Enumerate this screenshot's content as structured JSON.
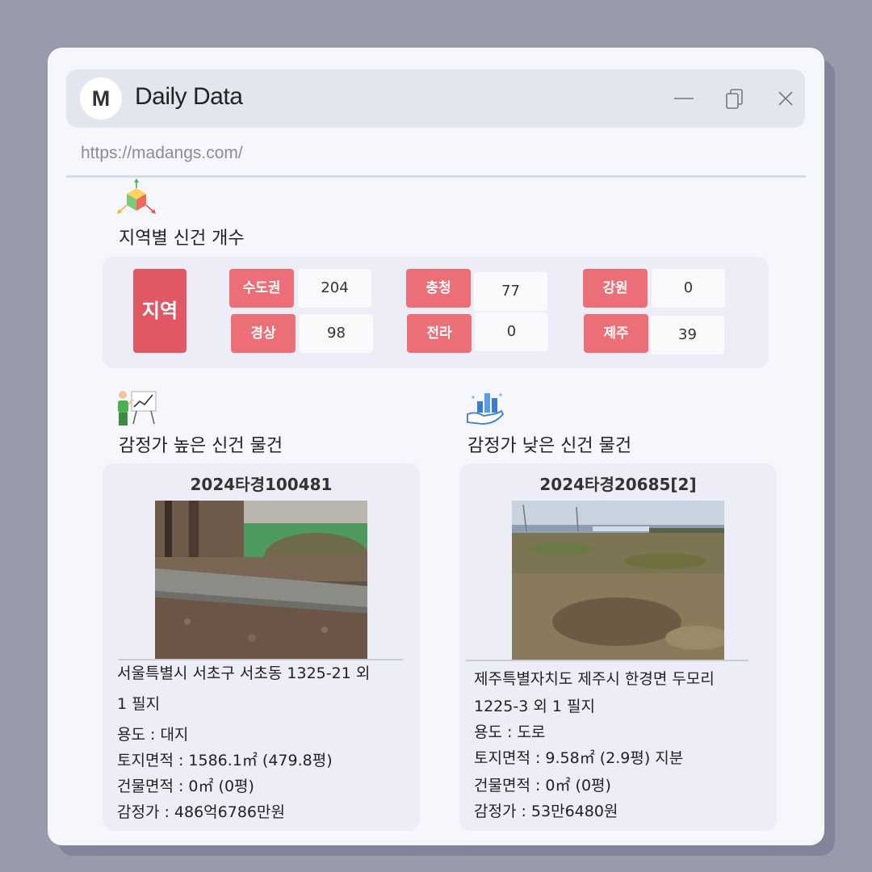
{
  "window": {
    "avatar_letter": "M",
    "title": "Daily Data",
    "url": "https://madangs.com/"
  },
  "icons": {
    "minimize": "minimize-icon",
    "restore": "restore-icon",
    "close": "close-icon",
    "region_section": "cube-axes-icon",
    "high_section": "presentation-chart-icon",
    "low_section": "hand-bar-chart-icon"
  },
  "region_section": {
    "title": "지역별 신건 개수",
    "main_label": "지역",
    "regions": [
      {
        "label": "수도권",
        "value": "204"
      },
      {
        "label": "경상",
        "value": "98"
      },
      {
        "label": "충청",
        "value": "77"
      },
      {
        "label": "전라",
        "value": "0"
      },
      {
        "label": "강원",
        "value": "0"
      },
      {
        "label": "제주",
        "value": "39"
      }
    ]
  },
  "high_section": {
    "title": "감정가 높은 신건 물건",
    "case_no": "2024타경100481",
    "address_line1": "서울특별시 서초구 서초동 1325-21 외",
    "address_line2": "1 필지",
    "usage": "용도 : 대지",
    "land_area": "토지면적 : 1586.1㎡ (479.8평)",
    "building_area": "건물면적 : 0㎡ (0평)",
    "appraisal": "감정가 : 486억6786만원"
  },
  "low_section": {
    "title": "감정가 낮은 신건 물건",
    "case_no": "2024타경20685[2]",
    "address_line1": "제주특별자치도 제주시 한경면 두모리",
    "address_line2": "1225-3 외 1 필지",
    "usage": "용도 :  도로",
    "land_area": "토지면적 : 9.58㎡ (2.9평) 지분",
    "building_area": "건물면적 : 0㎡ (0평)",
    "appraisal": "감정가 : 53만6480원"
  },
  "colors": {
    "accent_red": "#e05864",
    "label_red": "#ec6e76",
    "card_bg": "#ecedf6",
    "window_bg": "#f6f7fd"
  }
}
